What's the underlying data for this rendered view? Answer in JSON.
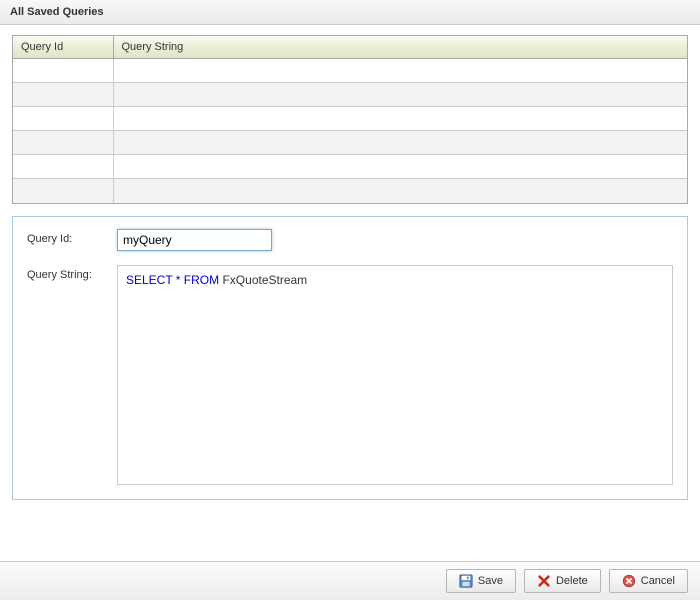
{
  "header": {
    "title": "All Saved Queries"
  },
  "table": {
    "columns": [
      "Query Id",
      "Query String"
    ],
    "rows": [
      {
        "id": "",
        "str": ""
      },
      {
        "id": "",
        "str": ""
      },
      {
        "id": "",
        "str": ""
      },
      {
        "id": "",
        "str": ""
      },
      {
        "id": "",
        "str": ""
      },
      {
        "id": "",
        "str": ""
      }
    ]
  },
  "form": {
    "queryIdLabel": "Query Id:",
    "queryStringLabel": "Query String:",
    "queryIdValue": "myQuery",
    "queryString": {
      "keywords": "SELECT * FROM",
      "rest": " FxQuoteStream"
    }
  },
  "buttons": {
    "save": "Save",
    "delete": "Delete",
    "cancel": "Cancel"
  }
}
